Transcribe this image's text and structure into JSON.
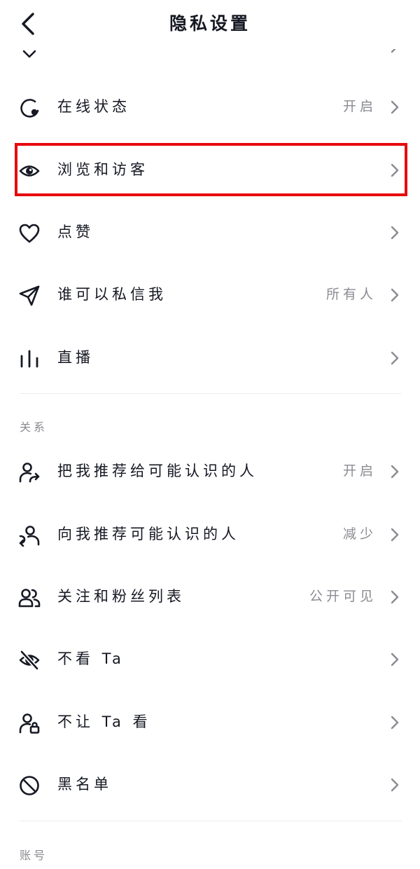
{
  "header": {
    "title": "隐私设置"
  },
  "rows_top": [
    {
      "label": "在线状态",
      "value": "开启",
      "icon": "online-status-icon"
    },
    {
      "label": "浏览和访客",
      "value": "",
      "icon": "eye-icon"
    },
    {
      "label": "点赞",
      "value": "",
      "icon": "heart-icon"
    },
    {
      "label": "谁可以私信我",
      "value": "所有人",
      "icon": "paper-plane-icon"
    },
    {
      "label": "直播",
      "value": "",
      "icon": "live-bars-icon"
    }
  ],
  "sections": {
    "relations": {
      "title": "关系",
      "rows": [
        {
          "label": "把我推荐给可能认识的人",
          "value": "开启",
          "icon": "user-share-icon"
        },
        {
          "label": "向我推荐可能认识的人",
          "value": "减少",
          "icon": "user-recommend-icon"
        },
        {
          "label": "关注和粉丝列表",
          "value": "公开可见",
          "icon": "users-icon"
        },
        {
          "label": "不看 Ta",
          "value": "",
          "icon": "eye-off-icon"
        },
        {
          "label": "不让 Ta 看",
          "value": "",
          "icon": "user-lock-icon"
        },
        {
          "label": "黑名单",
          "value": "",
          "icon": "block-icon"
        }
      ]
    },
    "account": {
      "title": "账号"
    }
  },
  "colors": {
    "highlight": "#e8090d",
    "text": "#161823",
    "secondary": "#8a8b91",
    "divider": "#ececec"
  }
}
